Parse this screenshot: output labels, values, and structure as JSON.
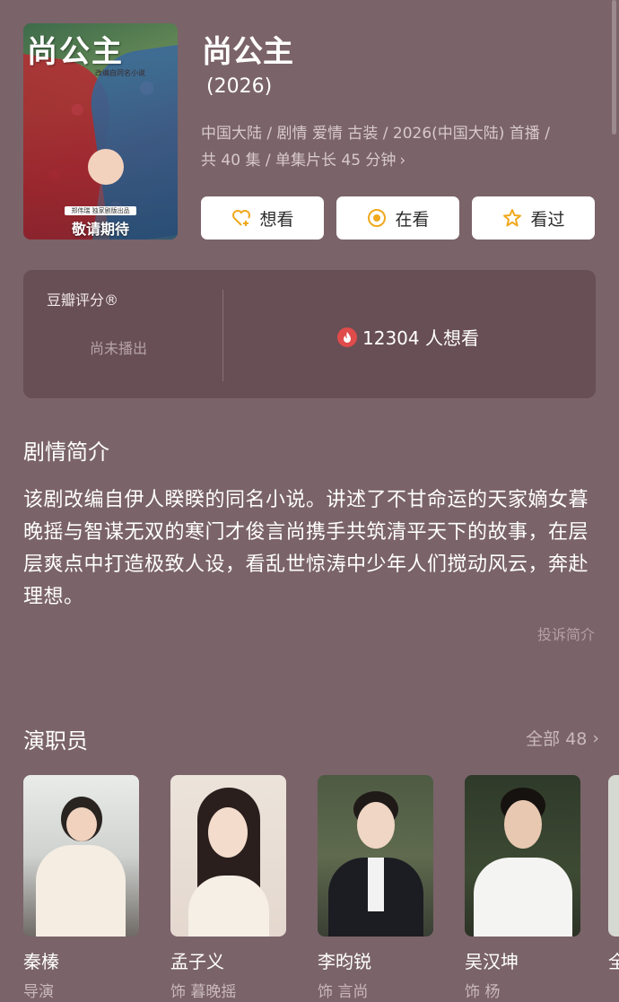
{
  "show": {
    "title": "尚公主",
    "year": "(2026)",
    "meta_line1": "中国大陆 / 剧情 爱情 古装 / 2026(中国大陆) 首播 /",
    "meta_line2": "共 40 集 / 单集片长 45 分钟",
    "poster": {
      "title": "尚公主",
      "subtitle": "改编自同名小说",
      "banner": "郑伟瑞 独家剧版出品",
      "cta": "敬请期待"
    }
  },
  "actions": {
    "want": "想看",
    "watching": "在看",
    "watched": "看过"
  },
  "rating": {
    "label": "豆瓣评分®",
    "status": "尚未播出",
    "want_count": "12304 人想看"
  },
  "synopsis": {
    "heading": "剧情简介",
    "text": "该剧改编自伊人睽睽的同名小说。讲述了不甘命运的天家嫡女暮晚摇与智谋无双的寒门才俊言尚携手共筑清平天下的故事，在层层爽点中打造极致人设，看乱世惊涛中少年人们搅动风云，奔赴理想。",
    "report": "投诉简介"
  },
  "cast": {
    "heading": "演职员",
    "all_label": "全部 48",
    "members": [
      {
        "name": "秦榛",
        "role": "导演"
      },
      {
        "name": "孟子义",
        "role": "饰 暮晚摇"
      },
      {
        "name": "李昀锐",
        "role": "饰 言尚"
      },
      {
        "name": "吴汉坤",
        "role": "饰 杨"
      }
    ],
    "partial_name": "全"
  },
  "colors": {
    "background": "#7a6369",
    "card": "#684f55",
    "icon_accent": "#f0a81d",
    "flame": "#e04b4b"
  }
}
